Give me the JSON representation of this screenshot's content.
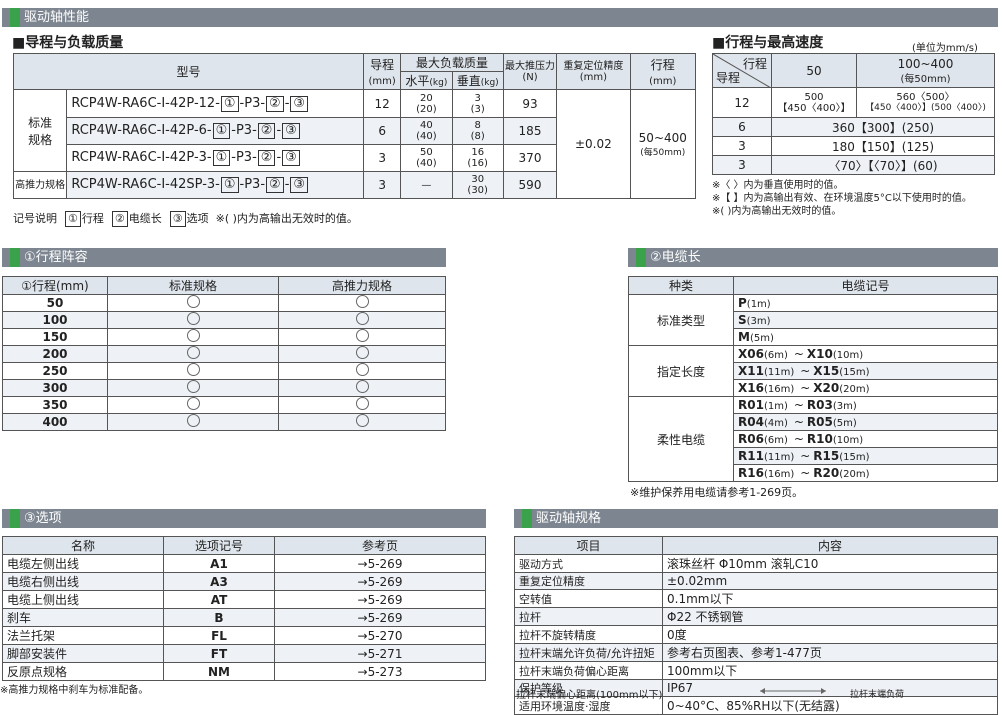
{
  "top_bar": "驱动轴性能",
  "lead_load": {
    "heading": "■导程与负载质量",
    "col_model": "型号",
    "col_lead": "导程",
    "col_lead_unit": "(mm)",
    "col_maxload": "最大负载质量",
    "col_horiz": "水平",
    "col_vert": "垂直",
    "unit_kg": "(kg)",
    "col_push": "最大推压力",
    "col_push_unit": "(N)",
    "col_repeat": "重复定位精度",
    "col_repeat_unit": "(mm)",
    "col_stroke": "行程",
    "col_stroke_unit": "(mm)",
    "group_std": "标准\n规格",
    "group_hi": "高推力规格",
    "repeat_value": "±0.02",
    "stroke_value": "50~400",
    "stroke_note": "(每50mm)",
    "rows": [
      {
        "model_prefix": "RCP4W-RA6C-I-42P-12-",
        "lead": "12",
        "h": "20",
        "h2": "(20)",
        "v": "3",
        "v2": "(3)",
        "push": "93"
      },
      {
        "model_prefix": "RCP4W-RA6C-I-42P-6-",
        "lead": "6",
        "h": "40",
        "h2": "(40)",
        "v": "8",
        "v2": "(8)",
        "push": "185"
      },
      {
        "model_prefix": "RCP4W-RA6C-I-42P-3-",
        "lead": "3",
        "h": "50",
        "h2": "(40)",
        "v": "16",
        "v2": "(16)",
        "push": "370"
      },
      {
        "model_prefix": "RCP4W-RA6C-I-42SP-3-",
        "lead": "3",
        "h": "—",
        "h2": "",
        "v": "30",
        "v2": "(30)",
        "push": "590"
      }
    ],
    "box1": "①",
    "box2": "②",
    "box3": "③",
    "p3": "-P3-",
    "dash": "-",
    "legend_prefix": "记号说明",
    "legend_1": "①",
    "legend_1_text": "行程",
    "legend_2": "②",
    "legend_2_text": "电缆长",
    "legend_3": "③",
    "legend_3_text": "选项",
    "legend_note": "※( )内为高输出无效时的值。"
  },
  "speed": {
    "heading": "■行程与最高速度",
    "unit": "(单位为mm/s)",
    "col_stroke": "行程",
    "col_lead": "导程",
    "col_50": "50",
    "col_100": "100~400",
    "col_100_sub": "(每50mm)",
    "rows": [
      {
        "lead": "12",
        "c1": "500",
        "c1b": "【450〈400〉】",
        "c2": "560〈500〉",
        "c2b": "【450〈400〉】(500〈400〉)"
      },
      {
        "lead": "6",
        "merged": "360【300】(250)"
      },
      {
        "lead": "3",
        "merged": "180【150】(125)"
      },
      {
        "lead": "3",
        "merged": "〈70〉【〈70〉】(60)"
      }
    ],
    "notes": [
      "※〈 〉内为垂直使用时的值。",
      "※【 】内为高输出有效、在环境温度5°C以下使用时的值。",
      "※( )内为高输出无效时的值。"
    ]
  },
  "stroke_list": {
    "title": "①行程阵容",
    "col_stroke": "①行程(mm)",
    "col_std": "标准规格",
    "col_hi": "高推力规格",
    "rows": [
      "50",
      "100",
      "150",
      "200",
      "250",
      "300",
      "350",
      "400"
    ]
  },
  "cable": {
    "title": "②电缆长",
    "col_type": "种类",
    "col_code": "电缆记号",
    "groups": [
      {
        "name": "标准类型",
        "items": [
          {
            "a": "P",
            "al": "(1m)"
          },
          {
            "a": "S",
            "al": "(3m)"
          },
          {
            "a": "M",
            "al": "(5m)"
          }
        ]
      },
      {
        "name": "指定长度",
        "items": [
          {
            "a": "X06",
            "al": "(6m)",
            "b": "X10",
            "bl": "(10m)"
          },
          {
            "a": "X11",
            "al": "(11m)",
            "b": "X15",
            "bl": "(15m)"
          },
          {
            "a": "X16",
            "al": "(16m)",
            "b": "X20",
            "bl": "(20m)"
          }
        ]
      },
      {
        "name": "柔性电缆",
        "items": [
          {
            "a": "R01",
            "al": "(1m)",
            "b": "R03",
            "bl": "(3m)"
          },
          {
            "a": "R04",
            "al": "(4m)",
            "b": "R05",
            "bl": "(5m)"
          },
          {
            "a": "R06",
            "al": "(6m)",
            "b": "R10",
            "bl": "(10m)"
          },
          {
            "a": "R11",
            "al": "(11m)",
            "b": "R15",
            "bl": "(15m)"
          },
          {
            "a": "R16",
            "al": "(16m)",
            "b": "R20",
            "bl": "(20m)"
          }
        ]
      }
    ],
    "tilde": "~",
    "note": "※维护保养用电缆请参考1-269页。"
  },
  "options": {
    "title": "③选项",
    "col_name": "名称",
    "col_code": "选项记号",
    "col_ref": "参考页",
    "rows": [
      {
        "name": "电缆左侧出线",
        "code": "A1",
        "ref": "→5-269"
      },
      {
        "name": "电缆右侧出线",
        "code": "A3",
        "ref": "→5-269"
      },
      {
        "name": "电缆上侧出线",
        "code": "AT",
        "ref": "→5-269"
      },
      {
        "name": "刹车",
        "code": "B",
        "ref": "→5-269"
      },
      {
        "name": "法兰托架",
        "code": "FL",
        "ref": "→5-270"
      },
      {
        "name": "脚部安装件",
        "code": "FT",
        "ref": "→5-271"
      },
      {
        "name": "反原点规格",
        "code": "NM",
        "ref": "→5-273"
      }
    ],
    "note": "※高推力规格中刹车为标准配备。"
  },
  "spec": {
    "title": "驱动轴规格",
    "col_item": "项目",
    "col_content": "内容",
    "rows": [
      {
        "item": "驱动方式",
        "content": "滚珠丝杆  Φ10mm  滚轧C10"
      },
      {
        "item": "重复定位精度",
        "content": "±0.02mm"
      },
      {
        "item": "空转值",
        "content": "0.1mm以下"
      },
      {
        "item": "拉杆",
        "content": "Φ22  不锈钢管"
      },
      {
        "item": "拉杆不旋转精度",
        "content": "0度"
      },
      {
        "item": "拉杆末端允许负荷/允许扭矩",
        "content": "参考右页图表、参考1-477页"
      },
      {
        "item": "拉杆末端负荷偏心距离",
        "content": "100mm以下"
      },
      {
        "item": "保护等级",
        "content": "IP67"
      },
      {
        "item": "适用环境温度·湿度",
        "content": "0~40°C、85%RH以下(无结露)"
      }
    ],
    "bottom_label": "拉杆末端偏心距离(100mm以下)",
    "bottom_label2": "拉杆末端负荷"
  }
}
